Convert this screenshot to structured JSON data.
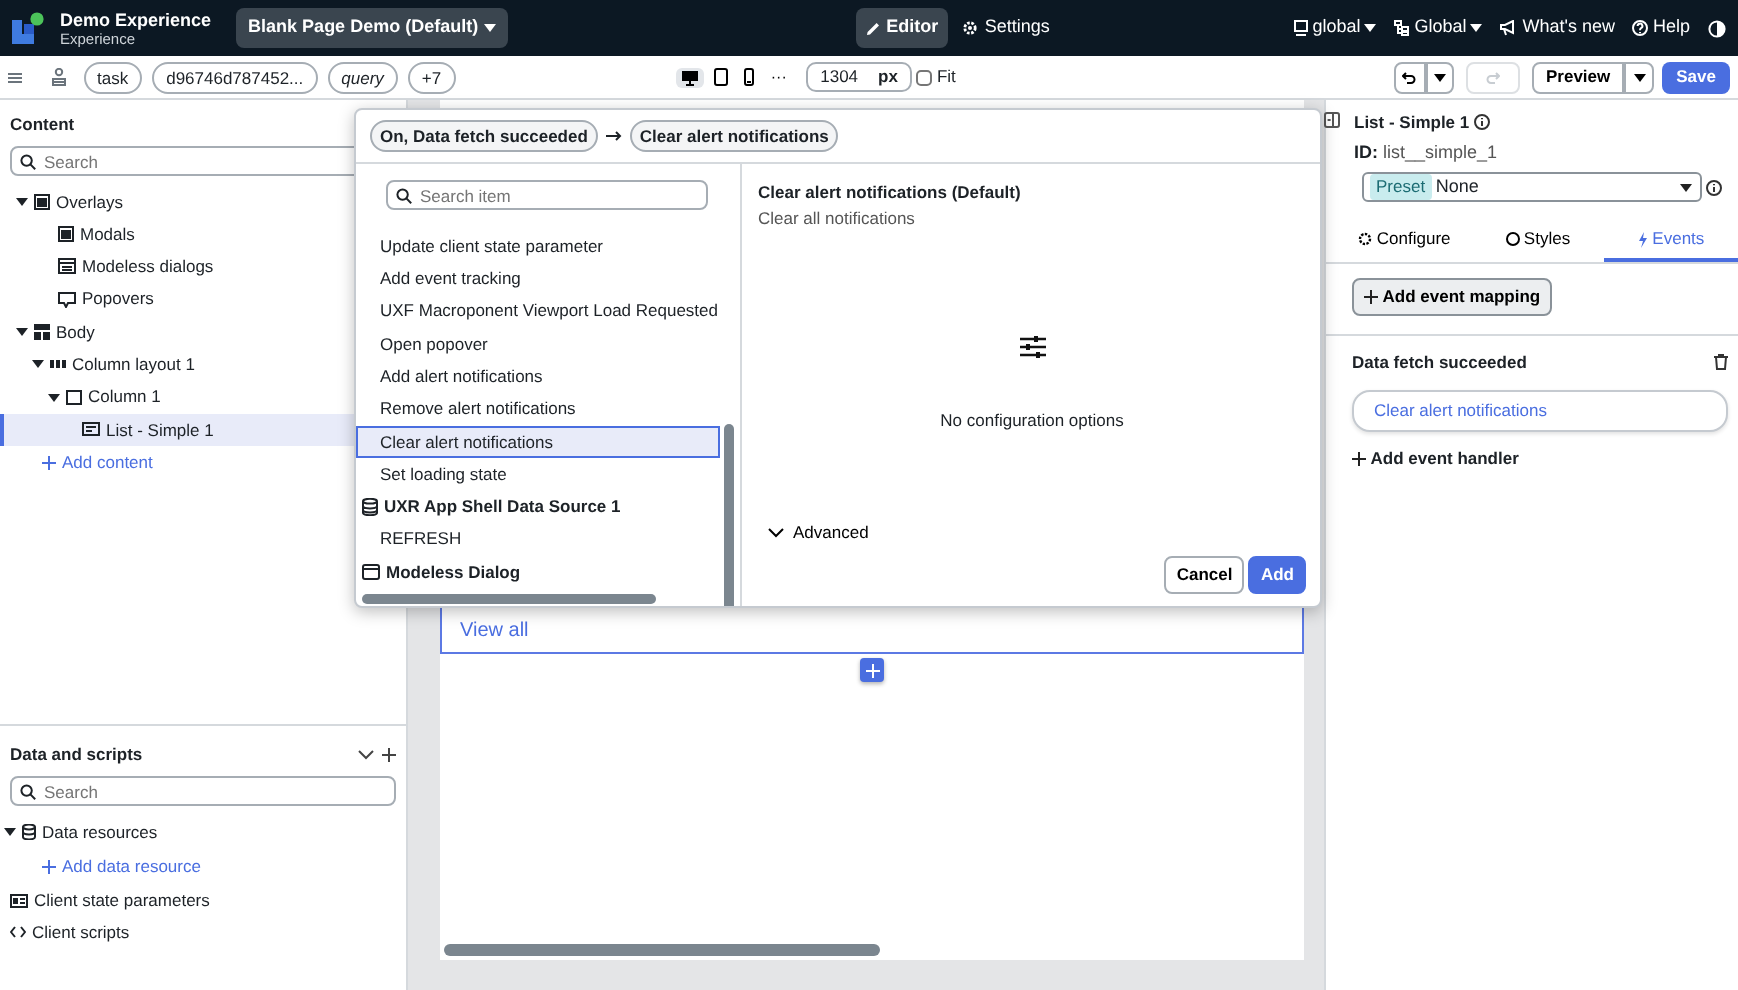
{
  "top_bar": {
    "app_title": "Demo Experience",
    "app_subtitle": "Experience",
    "page_selector": "Blank Page Demo (Default)",
    "modes": [
      {
        "label": "Editor",
        "kind": "editor",
        "selected": true
      },
      {
        "label": "Settings",
        "kind": "settings",
        "selected": false
      }
    ],
    "menus": [
      {
        "label": "global",
        "kind": "scope",
        "dropdown": true
      },
      {
        "label": "Global",
        "kind": "hierarchy",
        "dropdown": true
      },
      {
        "label": "What's new",
        "kind": "news",
        "dropdown": false
      },
      {
        "label": "Help",
        "kind": "help",
        "dropdown": false
      }
    ]
  },
  "toolbar": {
    "chips": [
      {
        "label": "task",
        "italic": false
      },
      {
        "label": "d96746d787452...",
        "italic": false
      },
      {
        "label": "query",
        "italic": true
      },
      {
        "label": "+7",
        "italic": false
      }
    ],
    "devices": [
      {
        "kind": "desktop",
        "selected": true
      },
      {
        "kind": "tablet",
        "selected": false
      },
      {
        "kind": "phone",
        "selected": false
      }
    ],
    "more": "···",
    "width_value": "1304",
    "width_unit": "px",
    "fit": {
      "label": "Fit",
      "checked": false
    },
    "redo_disabled": true,
    "preview": "Preview",
    "save": "Save"
  },
  "content_panel": {
    "title": "Content",
    "search_placeholder": "Search",
    "add_label": "Add content",
    "tree": [
      {
        "label": "Overlays",
        "kind": "overlay",
        "expanded": true,
        "selected": false,
        "children": [
          {
            "label": "Modals",
            "kind": "overlay",
            "selected": false
          },
          {
            "label": "Modeless dialogs",
            "kind": "modeless",
            "selected": false
          },
          {
            "label": "Popovers",
            "kind": "popover",
            "selected": false
          }
        ]
      },
      {
        "label": "Body",
        "kind": "body",
        "expanded": true,
        "selected": false,
        "children": [
          {
            "label": "Column layout 1",
            "kind": "columns",
            "expanded": true,
            "selected": false,
            "children": [
              {
                "label": "Column 1",
                "kind": "column",
                "expanded": true,
                "selected": false,
                "children": [
                  {
                    "label": "List - Simple 1",
                    "kind": "list",
                    "selected": true
                  }
                ]
              }
            ]
          }
        ]
      }
    ]
  },
  "canvas": {
    "link": "View all"
  },
  "dialog": {
    "breadcrumb": [
      "On, Data fetch succeeded",
      "Clear alert notifications"
    ],
    "search_placeholder": "Search item",
    "items": [
      {
        "label": "Update client state parameter",
        "kind": "action",
        "selected": false
      },
      {
        "label": "Add event tracking",
        "kind": "action",
        "selected": false
      },
      {
        "label": "UXF Macroponent Viewport Load Requested",
        "kind": "action",
        "selected": false
      },
      {
        "label": "Open popover",
        "kind": "action",
        "selected": false
      },
      {
        "label": "Add alert notifications",
        "kind": "action",
        "selected": false
      },
      {
        "label": "Remove alert notifications",
        "kind": "action",
        "selected": false
      },
      {
        "label": "Clear alert notifications",
        "kind": "action",
        "selected": true
      },
      {
        "label": "Set loading state",
        "kind": "action",
        "selected": false
      },
      {
        "label": "UXR App Shell Data Source 1",
        "kind": "source",
        "selected": false
      },
      {
        "label": "REFRESH",
        "kind": "action",
        "selected": false
      },
      {
        "label": "Modeless Dialog",
        "kind": "dialog",
        "selected": false
      }
    ],
    "detail_title": "Clear alert notifications (Default)",
    "detail_subtitle": "Clear all notifications",
    "empty_text": "No configuration options",
    "advanced": {
      "label": "Advanced",
      "expanded": false
    },
    "buttons": [
      {
        "label": "Cancel",
        "kind": "secondary"
      },
      {
        "label": "Add",
        "kind": "primary"
      }
    ]
  },
  "properties_panel": {
    "title": "List - Simple 1",
    "id_label": "ID:",
    "id_value": "list__simple_1",
    "preset_badge": "Preset",
    "preset_value": "None",
    "tabs": [
      {
        "label": "Configure",
        "kind": "configure",
        "selected": false
      },
      {
        "label": "Styles",
        "kind": "styles",
        "selected": false
      },
      {
        "label": "Events",
        "kind": "events",
        "selected": true
      }
    ],
    "add_mapping": "Add event mapping",
    "event": {
      "name": "Data fetch succeeded",
      "handlers": [
        "Clear alert notifications"
      ],
      "add_handler": "Add event handler"
    }
  },
  "data_panel": {
    "title": "Data and scripts",
    "search_placeholder": "Search",
    "tree": [
      {
        "label": "Data resources",
        "kind": "database",
        "expanded": true,
        "add_label": "Add data resource"
      },
      {
        "label": "Client state parameters",
        "kind": "params"
      },
      {
        "label": "Client scripts",
        "kind": "scripts"
      }
    ]
  }
}
